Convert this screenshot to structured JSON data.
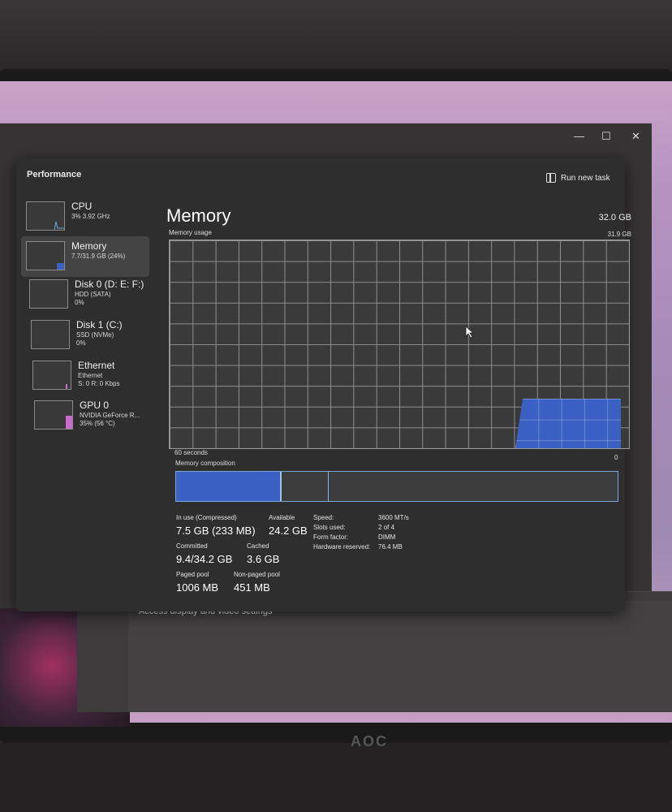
{
  "taskmgr": {
    "title": "Performance",
    "run_new_task": "Run new task",
    "more": "•••",
    "window_controls": {
      "minimize": "—",
      "maximize": "☐",
      "close": "✕"
    }
  },
  "sidebar": {
    "items": [
      {
        "name": "CPU",
        "sub1": "3% 3.92 GHz",
        "sub2": "",
        "sub3": ""
      },
      {
        "name": "Memory",
        "sub1": "7.7/31.9 GB (24%)",
        "sub2": "",
        "sub3": ""
      },
      {
        "name": "Disk 0 (D: E: F:)",
        "sub1": "HDD (SATA)",
        "sub2": "0%",
        "sub3": ""
      },
      {
        "name": "Disk 1 (C:)",
        "sub1": "SSD (NVMe)",
        "sub2": "0%",
        "sub3": ""
      },
      {
        "name": "Ethernet",
        "sub1": "Ethernet",
        "sub2": "S: 0 R: 0 Kbps",
        "sub3": ""
      },
      {
        "name": "GPU 0",
        "sub1": "NVIDIA GeForce R...",
        "sub2": "35% (56 °C)",
        "sub3": ""
      }
    ]
  },
  "main": {
    "title": "Memory",
    "total": "32.0 GB",
    "usage_label": "Memory usage",
    "usage_max": "31.9 GB",
    "time_label": "60 seconds",
    "zero_label": "0",
    "composition_label": "Memory composition",
    "usage_fraction": 0.24
  },
  "stats": {
    "in_use_label": "In use (Compressed)",
    "in_use_value": "7.5 GB (233 MB)",
    "available_label": "Available",
    "available_value": "24.2 GB",
    "committed_label": "Committed",
    "committed_value": "9.4/34.2 GB",
    "cached_label": "Cached",
    "cached_value": "3.6 GB",
    "paged_label": "Paged pool",
    "paged_value": "1006 MB",
    "nonpaged_label": "Non-paged pool",
    "nonpaged_value": "451 MB",
    "speed_label": "Speed:",
    "speed_value": "3600 MT/s",
    "slots_label": "Slots used:",
    "slots_value": "2 of 4",
    "form_label": "Form factor:",
    "form_value": "DIMM",
    "hw_label": "Hardware reserved:",
    "hw_value": "76.4 MB"
  },
  "background": {
    "settings_text": "Access display and video settings",
    "monitor_brand": "AOC"
  },
  "colors": {
    "accent": "#3b60c4",
    "window_bg": "#2f2e2f"
  }
}
